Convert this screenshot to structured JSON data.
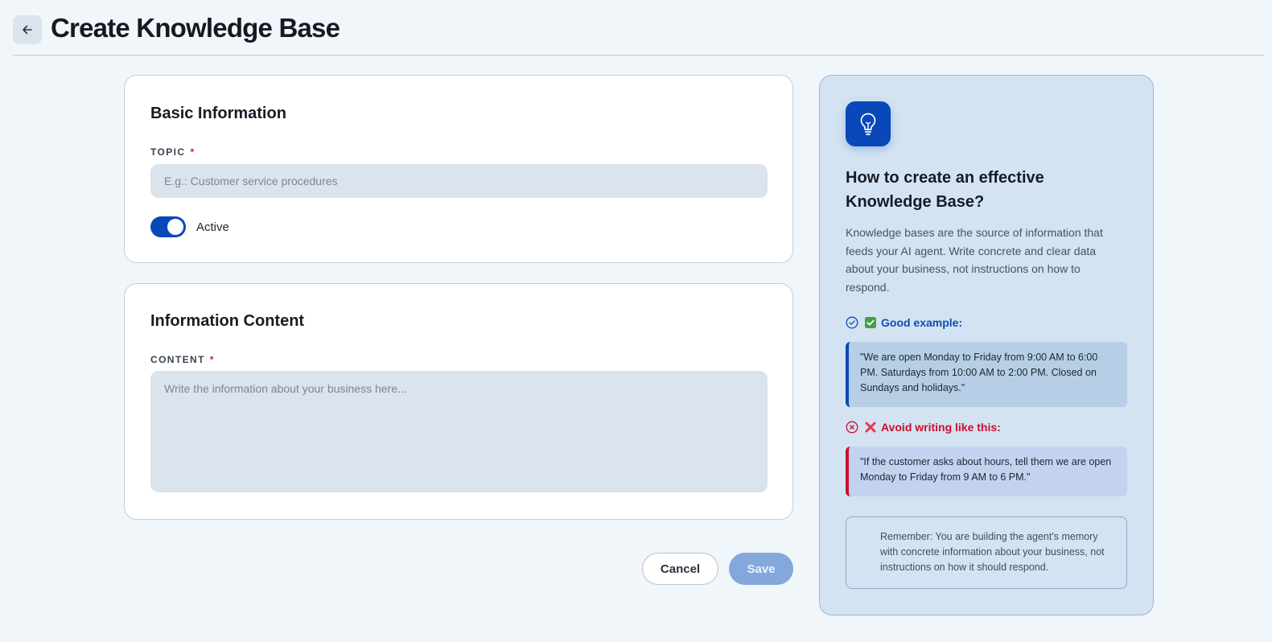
{
  "header": {
    "title": "Create Knowledge Base",
    "back_icon": "arrow-left-icon"
  },
  "basic_info": {
    "title": "Basic Information",
    "topic_label": "TOPIC",
    "required_mark": "*",
    "topic_placeholder": "E.g.: Customer service procedures",
    "topic_value": "",
    "toggle_label": "Active",
    "toggle_on": true
  },
  "info_content": {
    "title": "Information Content",
    "content_label": "CONTENT",
    "required_mark": "*",
    "content_placeholder": "Write the information about your business here...",
    "content_value": ""
  },
  "actions": {
    "cancel_label": "Cancel",
    "save_label": "Save"
  },
  "tips": {
    "icon": "lightbulb-icon",
    "title": "How to create an effective Knowledge Base?",
    "description": "Knowledge bases are the source of information that feeds your AI agent. Write concrete and clear data about your business, not instructions on how to respond.",
    "good_heading": "Good example:",
    "good_example": "\"We are open Monday to Friday from 9:00 AM to 6:00 PM. Saturdays from 10:00 AM to 2:00 PM. Closed on Sundays and holidays.\"",
    "bad_heading": "Avoid writing like this:",
    "bad_example": "\"If the customer asks about hours, tell them we are open Monday to Friday from 9 AM to 6 PM.\"",
    "note": "Remember: You are building the agent's memory with concrete information about your business, not instructions on how it should respond."
  },
  "colors": {
    "accent": "#0848b8",
    "good": "#0b4fb5",
    "bad": "#c8102e",
    "save_disabled": "#82a8dc"
  }
}
